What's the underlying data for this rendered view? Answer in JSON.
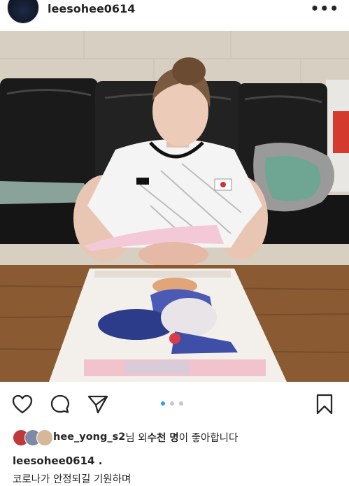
{
  "post": {
    "username": "leesohee0614",
    "more_icon": "more-horizontal-icon",
    "more_label": "•••"
  },
  "media": {
    "carousel_count": 3,
    "carousel_active": 0
  },
  "actions": {
    "like_icon": "heart-icon",
    "comment_icon": "comment-icon",
    "share_icon": "paper-plane-icon",
    "save_icon": "bookmark-icon"
  },
  "likes": {
    "user": "hee_yong_s2",
    "middle": "님 외 ",
    "count_text": "수천 명",
    "suffix": "이 좋아합니다"
  },
  "caption": {
    "user": "leesohee0614 .",
    "text": "코로나가 안정되길 기원하며"
  },
  "colors": {
    "accent_dot": "#3897f0",
    "text": "#262626"
  }
}
